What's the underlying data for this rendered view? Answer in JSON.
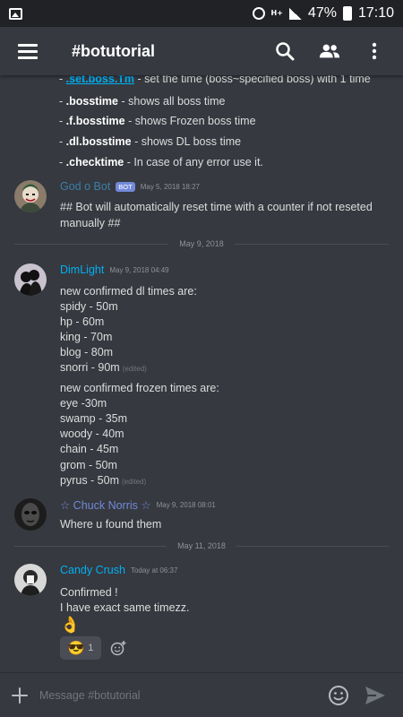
{
  "statusbar": {
    "battery": "47%",
    "time": "17:10",
    "network": "H+"
  },
  "header": {
    "channel": "#botutorial"
  },
  "commands": [
    {
      "cmd": ".set.boss.Tm",
      "desc": "- set the time (boss~specified boss) with 1 time"
    },
    {
      "cmd": ".bosstime",
      "desc": "- shows all boss time"
    },
    {
      "cmd": ".f.bosstime",
      "desc": "- shows Frozen boss time"
    },
    {
      "cmd": ".dl.bosstime",
      "desc": "- shows DL boss time"
    },
    {
      "cmd": ".checktime",
      "desc": "- In case of any error use it."
    }
  ],
  "msg_bot": {
    "username": "God o Bot",
    "tag": "BOT",
    "timestamp": "May 5, 2018 18:27",
    "line1": "## Bot will automatically reset time with a counter if not reseted",
    "line2": "manually ##"
  },
  "divider1": "May 9, 2018",
  "msg_dimlight": {
    "username": "DimLight",
    "timestamp": "May 9, 2018 04:49",
    "dl_header": "new confirmed dl times are:",
    "dl_lines": [
      "spidy - 50m",
      "hp - 60m",
      "king - 70m",
      "blog - 80m",
      "snorri - 90m"
    ],
    "frozen_header": "new confirmed frozen times are:",
    "frozen_lines": [
      "eye -30m",
      "swamp - 35m",
      "woody - 40m",
      "chain - 45m",
      "grom - 50m",
      "pyrus - 50m"
    ],
    "edited": "(edited)"
  },
  "msg_chuck": {
    "username": "☆ Chuck Norris ☆",
    "timestamp": "May 9, 2018 08:01",
    "text": "Where u found them"
  },
  "divider2": "May 11, 2018",
  "msg_candy": {
    "username": "Candy Crush",
    "timestamp": "Today at 06:37",
    "line1": "Confirmed !",
    "line2": "I have exact same timezz.",
    "emoji": "👌",
    "reaction_emoji": "😎",
    "reaction_count": "1"
  },
  "composer": {
    "placeholder": "Message #botutorial"
  },
  "colors": {
    "background": "#36393f",
    "header_bar": "#202225",
    "username_blue": "#00b0f4",
    "bot_username": "#3c7fa7",
    "bot_tag": "#7289da"
  }
}
